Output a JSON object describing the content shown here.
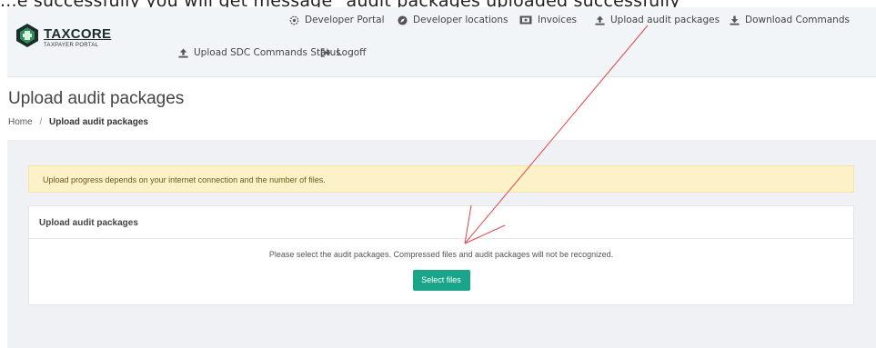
{
  "banner": {
    "text": "...e successfully you will get message \"audit packages uploaded successfully\""
  },
  "logo": {
    "title": "TAXCORE",
    "subtitle": "TAXPAYER PORTAL"
  },
  "nav": {
    "items": [
      {
        "label": "Developer Portal",
        "icon": "gear-icon"
      },
      {
        "label": "Developer locations",
        "icon": "compass-icon"
      },
      {
        "label": "Invoices",
        "icon": "invoice-icon"
      },
      {
        "label": "Upload audit packages",
        "icon": "upload-icon"
      },
      {
        "label": "Download Commands",
        "icon": "download-icon"
      },
      {
        "label": "Upload SDC Commands Status",
        "icon": "upload-icon"
      },
      {
        "label": "Logoff",
        "icon": "logoff-icon"
      }
    ]
  },
  "page": {
    "title": "Upload audit packages",
    "breadcrumb": {
      "home": "Home",
      "separator": "/",
      "current": "Upload audit packages"
    }
  },
  "alert": {
    "text": "Upload progress depends on your internet connection and the number of files."
  },
  "panel": {
    "header": "Upload audit packages",
    "instruction": "Please select the audit packages. Compressed files and audit packages will not be recognized.",
    "button_label": "Select files"
  },
  "colors": {
    "accent": "#1aa58a",
    "alert_bg": "#fcf1c7",
    "navbar_bg": "#f2f5f8",
    "annotation": "#e0474c"
  }
}
